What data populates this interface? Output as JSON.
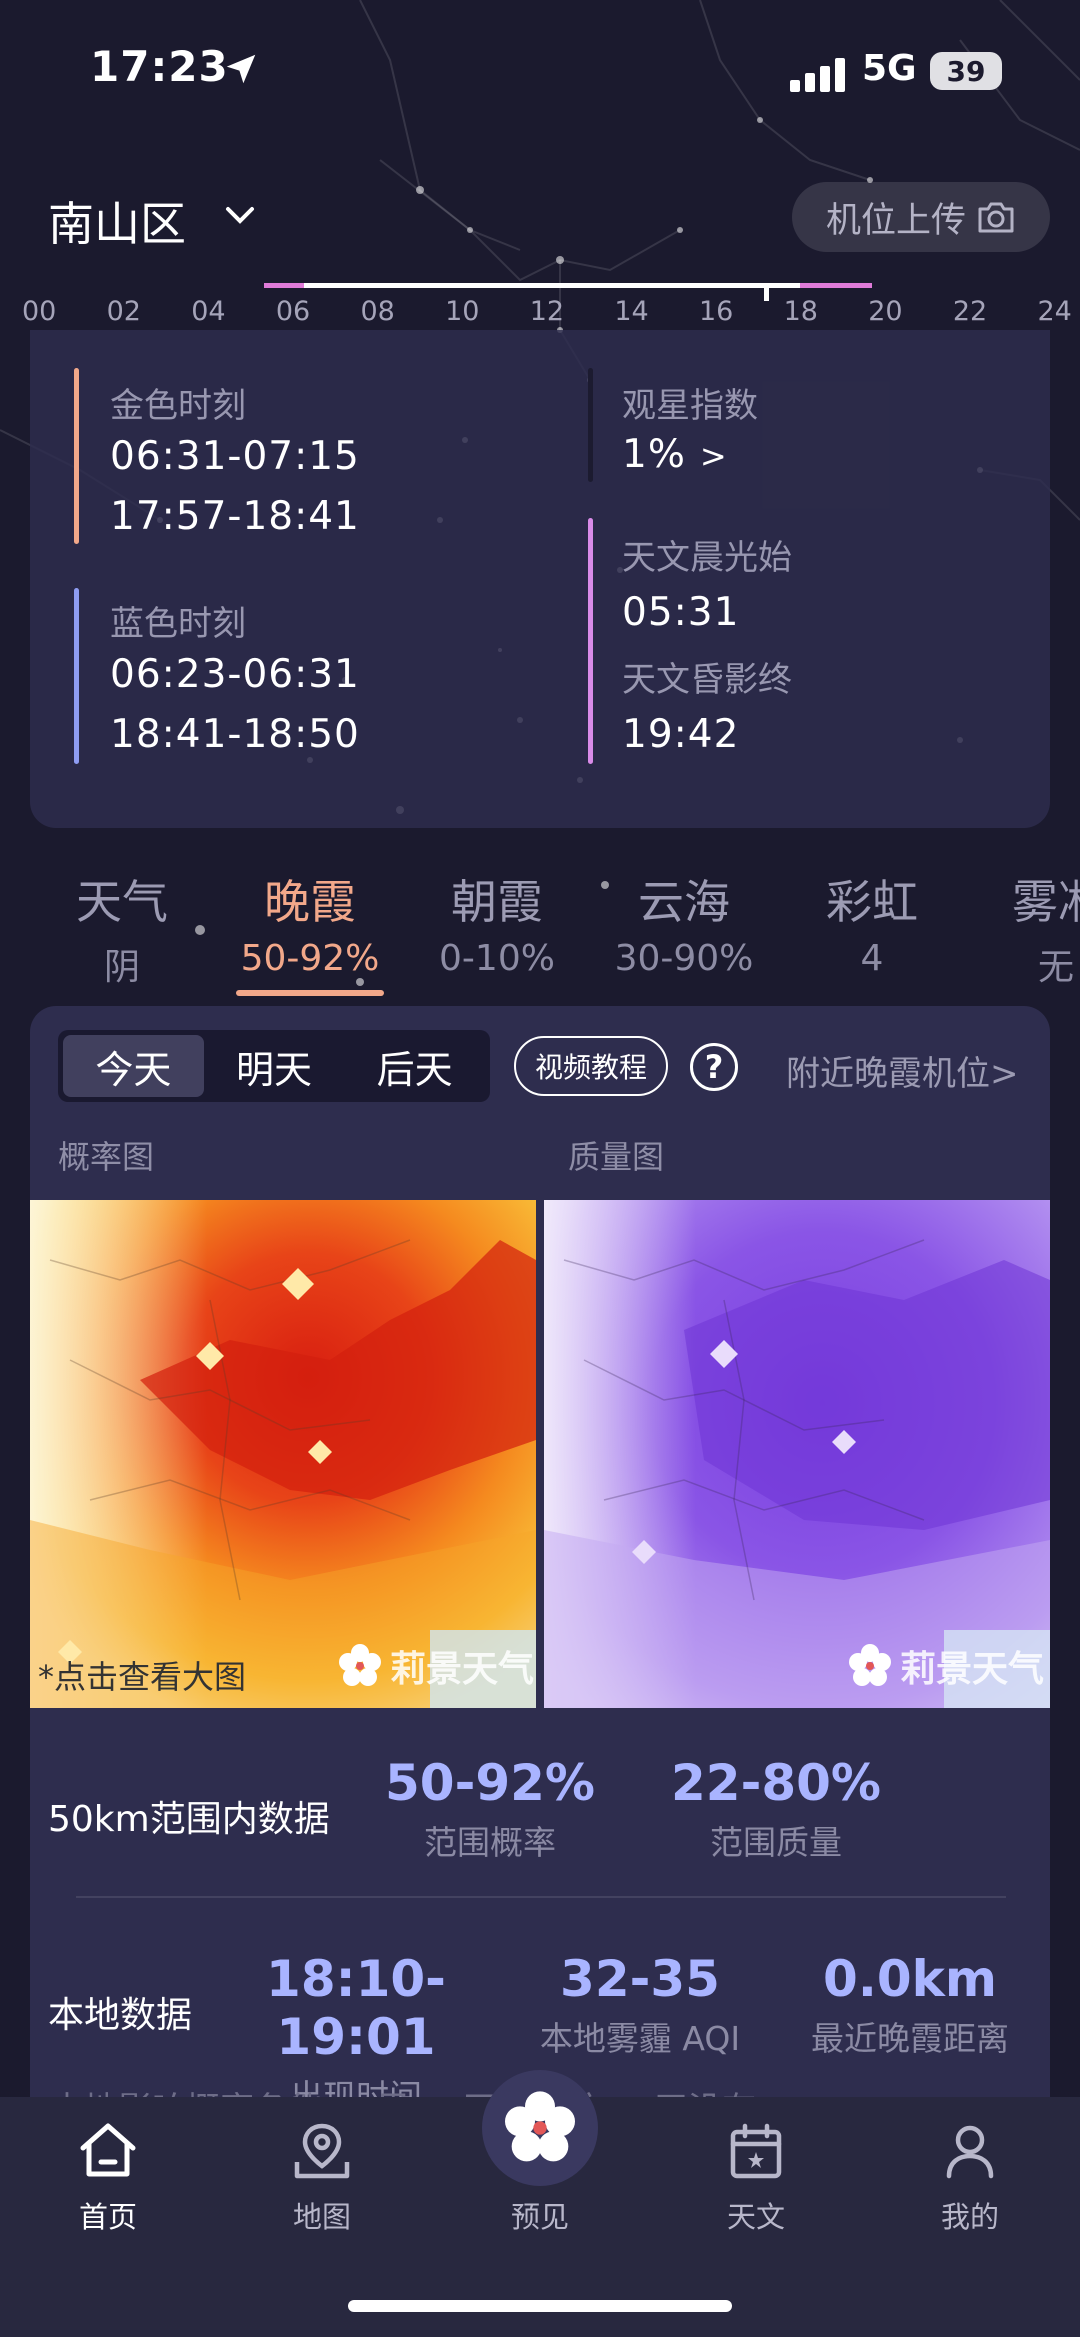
{
  "status_bar": {
    "time": "17:23",
    "network": "5G",
    "battery": "39"
  },
  "header": {
    "location": "南山区",
    "upload_label": "机位上传"
  },
  "timeline": {
    "hours": [
      "00",
      "02",
      "04",
      "06",
      "08",
      "10",
      "12",
      "14",
      "16",
      "18",
      "20",
      "22",
      "24"
    ]
  },
  "info": {
    "golden": {
      "label": "金色时刻",
      "morning": "06:31-07:15",
      "evening": "17:57-18:41"
    },
    "blue": {
      "label": "蓝色时刻",
      "morning": "06:23-06:31",
      "evening": "18:41-18:50"
    },
    "stargazing": {
      "label": "观星指数",
      "value": "1%",
      "chevron": ">"
    },
    "astro_dawn": {
      "label": "天文晨光始",
      "value": "05:31"
    },
    "astro_dusk": {
      "label": "天文昏影终",
      "value": "19:42"
    },
    "colors": {
      "golden": "#f2a88a",
      "blue": "#8e9cf2",
      "astro": "#d98be8"
    }
  },
  "tabs": [
    {
      "name": "天气",
      "value": "阴"
    },
    {
      "name": "晚霞",
      "value": "50-92%",
      "active": true
    },
    {
      "name": "朝霞",
      "value": "0-10%"
    },
    {
      "name": "云海",
      "value": "30-90%"
    },
    {
      "name": "彩虹",
      "value": "4"
    },
    {
      "name": "雾凇",
      "value": "无"
    }
  ],
  "day_selector": {
    "today": "今天",
    "tomorrow": "明天",
    "day_after": "后天"
  },
  "video_tutorial": "视频教程",
  "help_icon": "?",
  "nearby_label": "附近晚霞机位",
  "nearby_chevron": ">",
  "maps": {
    "probability_title": "概率图",
    "quality_title": "质量图",
    "hint": "*点击查看大图",
    "watermark": "莉景天气"
  },
  "range_stats": {
    "label": "50km范围内数据",
    "probability": {
      "value": "50-92%",
      "caption": "范围概率"
    },
    "quality": {
      "value": "22-80%",
      "caption": "范围质量"
    }
  },
  "local_stats": {
    "label": "本地数据",
    "time": {
      "value": "18:10-19:01",
      "caption": "出现时间"
    },
    "aqi": {
      "value": "32-35",
      "caption": "本地雾霾 AQI"
    },
    "distance": {
      "value": "0.0km",
      "caption": "最近晚霞距离"
    }
  },
  "peek_text": "本地影响概率条件 ... 里 ... 可能性较 ... 天没有 ...",
  "bottom_nav": [
    {
      "label": "首页",
      "icon": "home-icon",
      "active": true
    },
    {
      "label": "地图",
      "icon": "map-pin-icon"
    },
    {
      "label": "预见",
      "icon": "plum-blossom-icon"
    },
    {
      "label": "天文",
      "icon": "calendar-icon"
    },
    {
      "label": "我的",
      "icon": "user-icon"
    }
  ],
  "accent_color": "#a9b4ff"
}
